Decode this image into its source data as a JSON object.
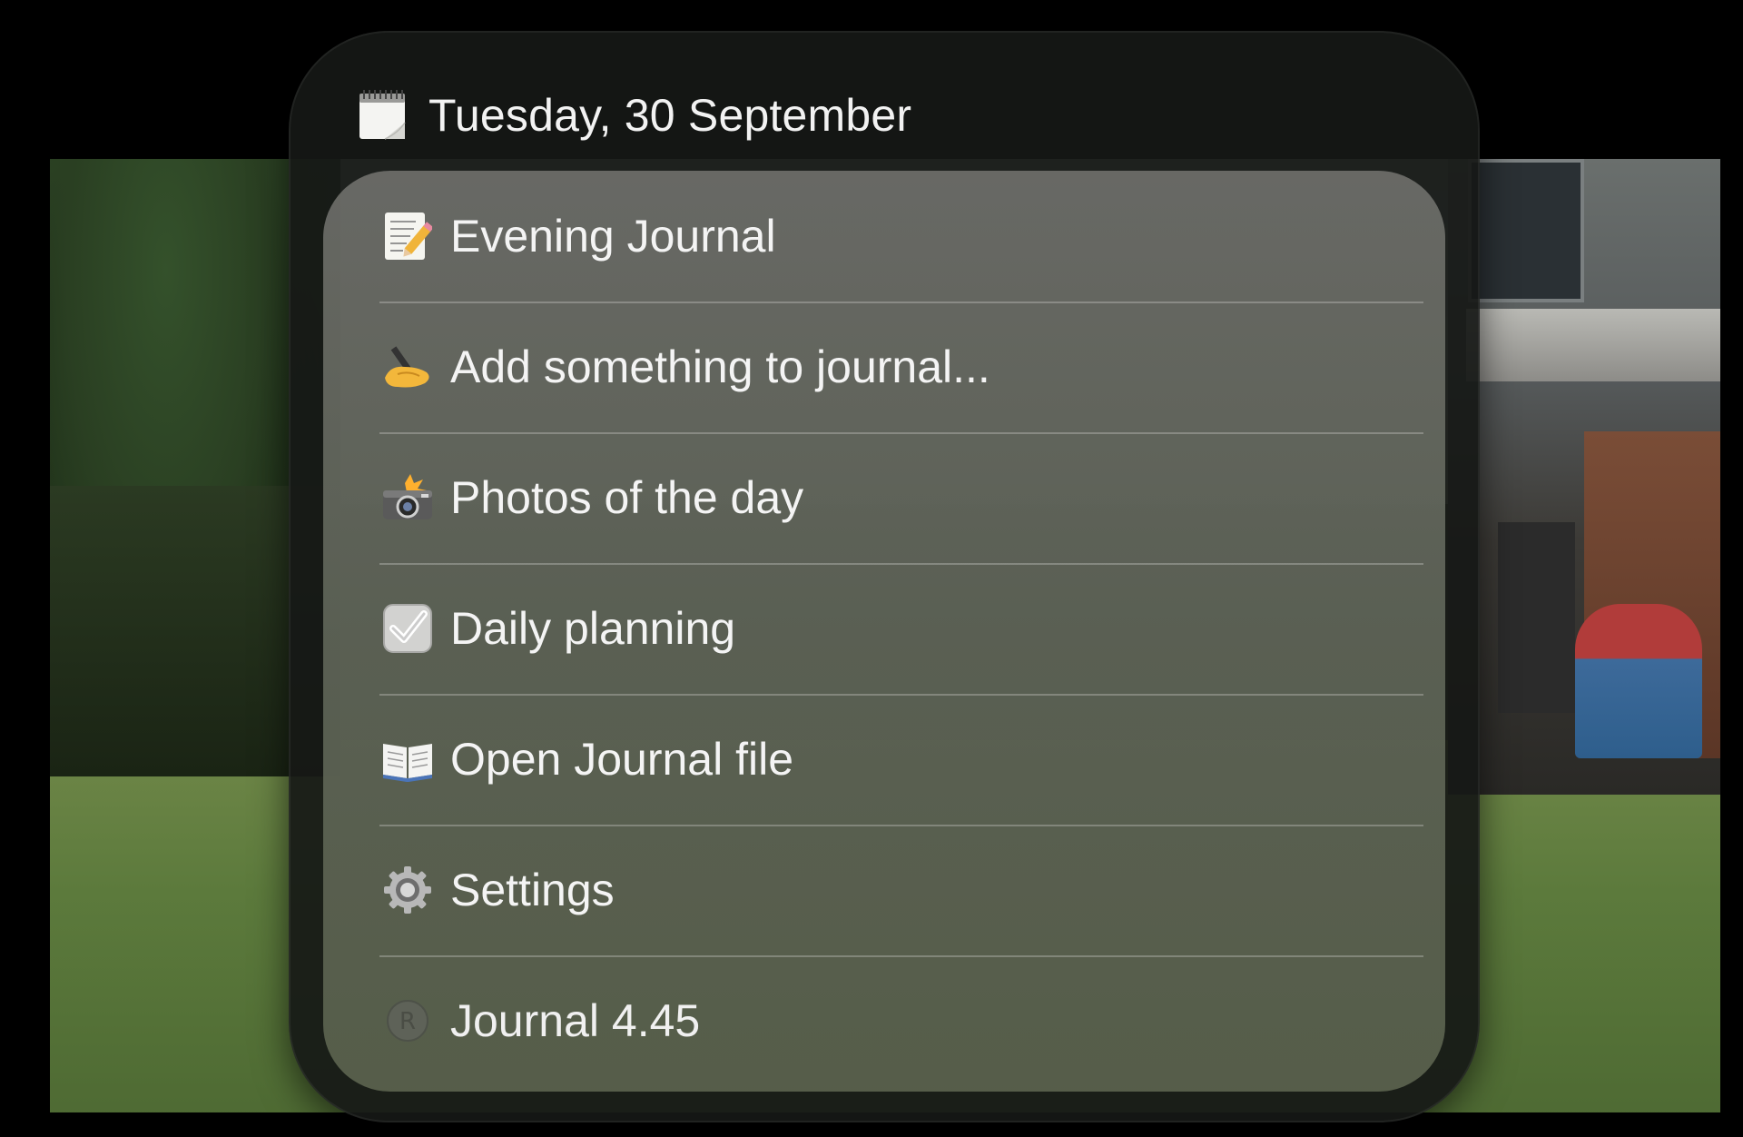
{
  "header": {
    "date": "Tuesday, 30 September",
    "icon": "calendar-icon"
  },
  "menu": {
    "items": [
      {
        "label": "Evening Journal",
        "icon": "memo-icon"
      },
      {
        "label": "Add something to journal...",
        "icon": "writing-hand-icon"
      },
      {
        "label": "Photos of the day",
        "icon": "camera-flash-icon"
      },
      {
        "label": "Daily planning",
        "icon": "check-box-icon"
      },
      {
        "label": "Open Journal file",
        "icon": "open-book-icon"
      },
      {
        "label": "Settings",
        "icon": "gear-icon"
      },
      {
        "label": "Journal 4.45",
        "icon": "registered-icon"
      }
    ]
  },
  "colors": {
    "panel_bg": "#161816",
    "card_bg": "#6f716a",
    "text": "#f4f4f4",
    "divider": "#c8c8c2"
  }
}
